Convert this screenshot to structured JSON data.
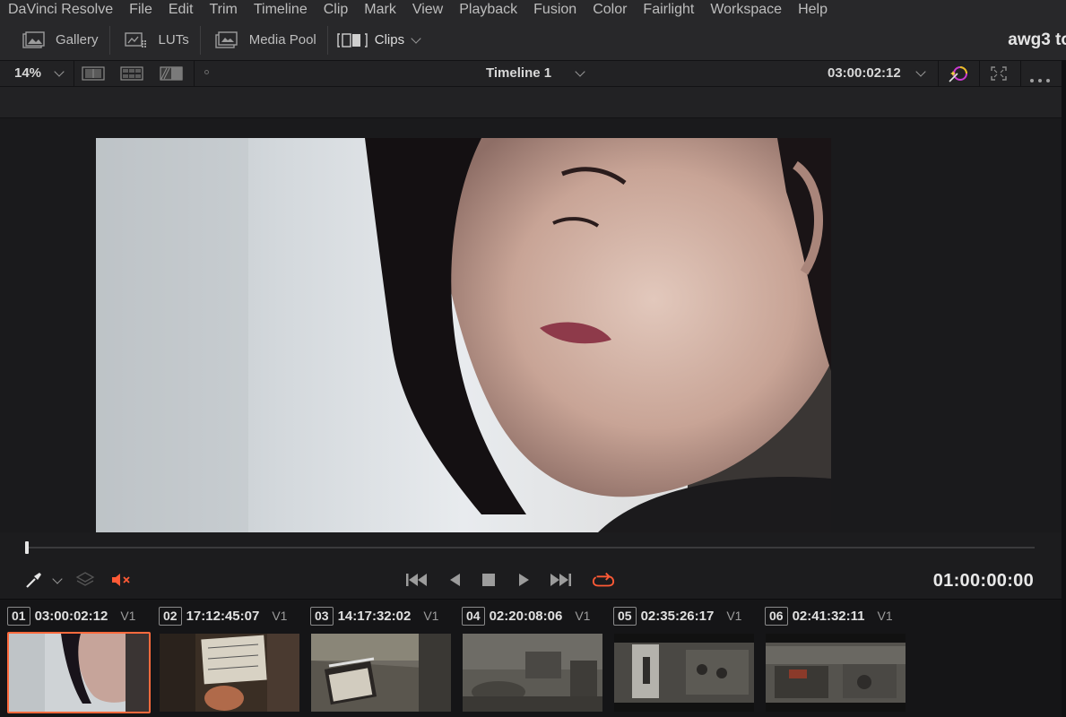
{
  "menu": [
    "DaVinci Resolve",
    "File",
    "Edit",
    "Trim",
    "Timeline",
    "Clip",
    "Mark",
    "View",
    "Playback",
    "Fusion",
    "Color",
    "Fairlight",
    "Workspace",
    "Help"
  ],
  "toolbar": {
    "gallery": "Gallery",
    "luts": "LUTs",
    "media_pool": "Media Pool",
    "clips": "Clips",
    "project_name": "awg3 to"
  },
  "viewer": {
    "zoom": "14%",
    "timeline_name": "Timeline 1",
    "source_timecode": "03:00:02:12"
  },
  "transport": {
    "timecode": "01:00:00:00",
    "accent_color": "#ff5a36"
  },
  "clips": [
    {
      "num": "01",
      "tc": "03:00:02:12",
      "track": "V1",
      "selected": true
    },
    {
      "num": "02",
      "tc": "17:12:45:07",
      "track": "V1",
      "selected": false
    },
    {
      "num": "03",
      "tc": "14:17:32:02",
      "track": "V1",
      "selected": false
    },
    {
      "num": "04",
      "tc": "02:20:08:06",
      "track": "V1",
      "selected": false
    },
    {
      "num": "05",
      "tc": "02:35:26:17",
      "track": "V1",
      "selected": false
    },
    {
      "num": "06",
      "tc": "02:41:32:11",
      "track": "V1",
      "selected": false
    }
  ]
}
